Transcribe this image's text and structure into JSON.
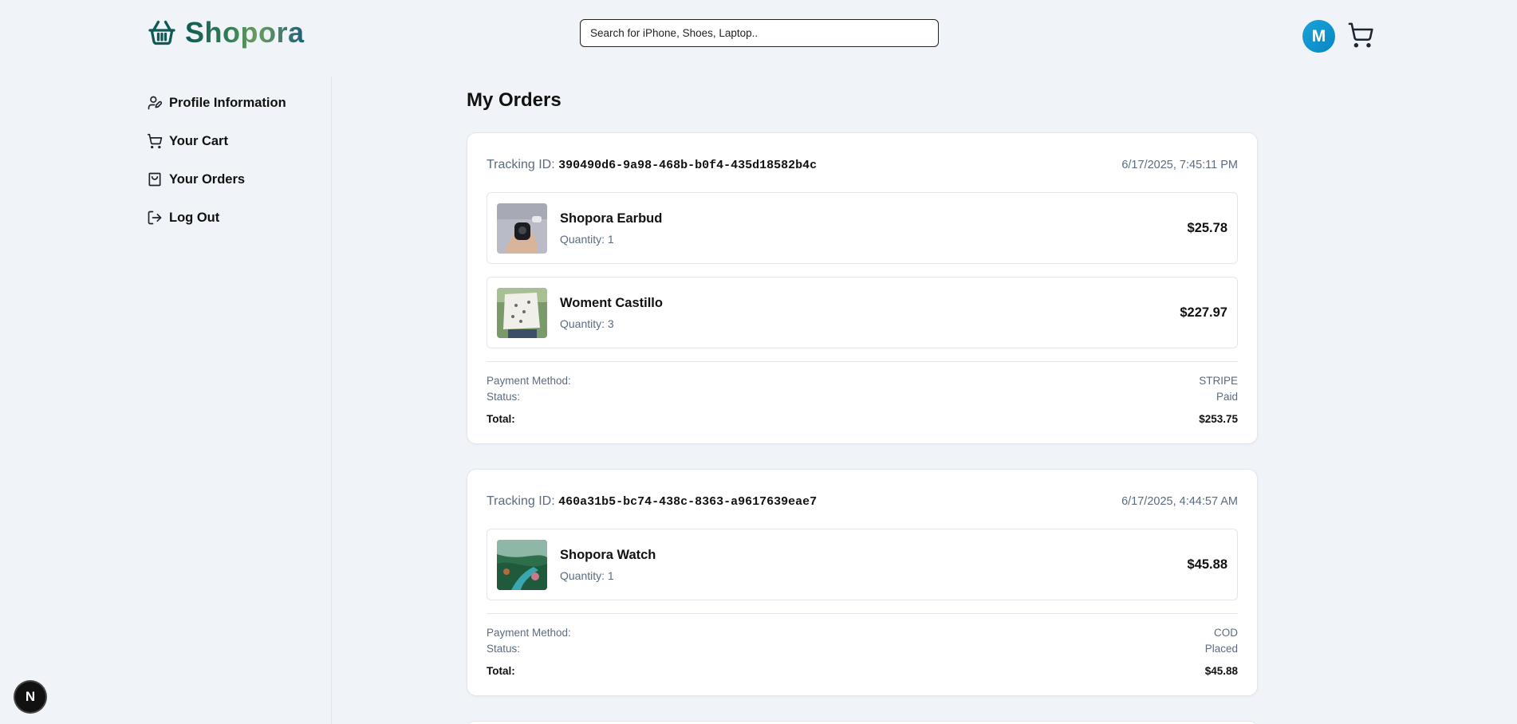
{
  "brand": {
    "name": "Shopora"
  },
  "search": {
    "placeholder": "Search for iPhone, Shoes, Laptop.."
  },
  "user": {
    "initial": "M"
  },
  "sidebar": {
    "items": [
      {
        "label": "Profile Information",
        "icon": "user-pen-icon"
      },
      {
        "label": "Your Cart",
        "icon": "cart-icon"
      },
      {
        "label": "Your Orders",
        "icon": "shopping-bag-icon"
      },
      {
        "label": "Log Out",
        "icon": "logout-icon"
      }
    ]
  },
  "main": {
    "title": "My Orders",
    "tracking_label": "Tracking ID:",
    "orders": [
      {
        "tracking_id": "390490d6-9a98-468b-b0f4-435d18582b4c",
        "date": "6/17/2025, 7:45:11 PM",
        "items": [
          {
            "name": "Shopora Earbud",
            "quantity": "Quantity: 1",
            "price": "$25.78"
          },
          {
            "name": "Woment Castillo",
            "quantity": "Quantity: 3",
            "price": "$227.97"
          }
        ],
        "payment_label": "Payment Method:",
        "payment_method": "STRIPE",
        "status_label": "Status:",
        "status": "Paid",
        "total_label": "Total:",
        "total": "$253.75"
      },
      {
        "tracking_id": "460a31b5-bc74-438c-8363-a9617639eae7",
        "date": "6/17/2025, 4:44:57 AM",
        "items": [
          {
            "name": "Shopora Watch",
            "quantity": "Quantity: 1",
            "price": "$45.88"
          }
        ],
        "payment_label": "Payment Method:",
        "payment_method": "COD",
        "status_label": "Status:",
        "status": "Placed",
        "total_label": "Total:",
        "total": "$45.88"
      }
    ]
  },
  "devtools": {
    "badge": "N"
  },
  "colors": {
    "accent": "#0786c4",
    "logo": "#0f5a56",
    "muted": "#5b6b80"
  }
}
